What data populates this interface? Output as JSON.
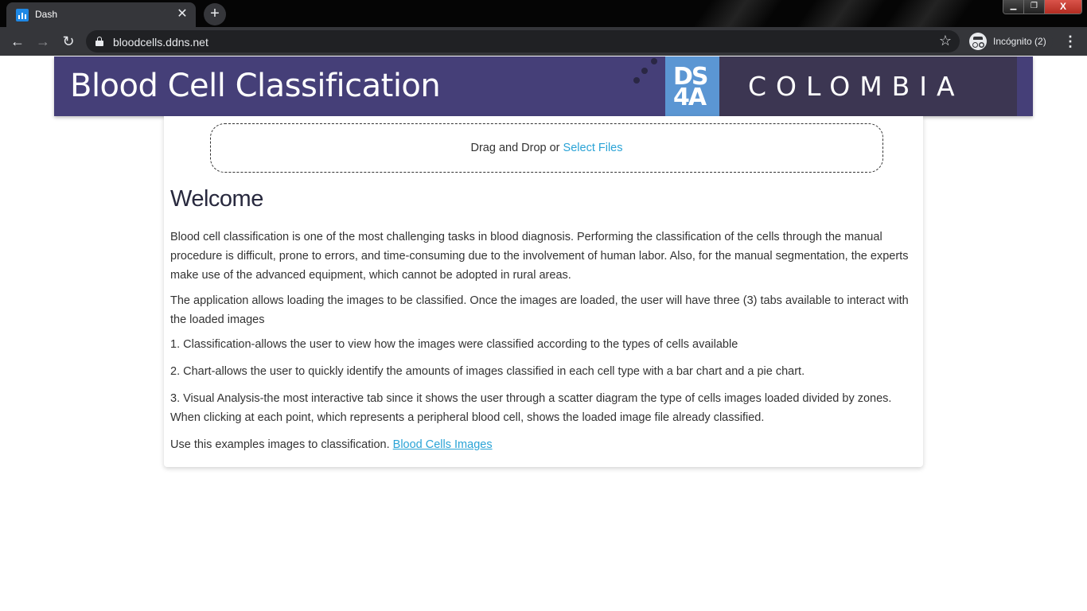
{
  "browser": {
    "tab_title": "Dash",
    "tab_close": "✕",
    "new_tab": "+",
    "url": "bloodcells.ddns.net",
    "incognito_label": "Incógnito (2)",
    "back_glyph": "←",
    "forward_glyph": "→",
    "reload_glyph": "↻",
    "star_glyph": "☆",
    "menu_glyph": "⋮",
    "win_minimize": "▁",
    "win_restore": "❐",
    "win_close": "X"
  },
  "header": {
    "title": "Blood Cell Classification",
    "logo_line1": "DS",
    "logo_line2": "4A",
    "logo_text": "COLOMBIA"
  },
  "upload": {
    "prompt": "Drag and Drop or ",
    "link": "Select Files"
  },
  "content": {
    "heading": "Welcome",
    "p1": "Blood cell classification is one of the most challenging tasks in blood diagnosis. Performing the classification of the cells through the manual procedure is difficult, prone to errors, and time-consuming due to the involvement of human labor. Also, for the manual segmentation, the experts make use of the advanced equipment, which cannot be adopted in rural areas.",
    "p2": "The application allows loading the images to be classified. Once the images are loaded, the user will have three (3) tabs available to interact with the loaded images",
    "item1": "1. Classification-allows the user to view how the images were classified according to the types of cells available",
    "item2": "2. Chart-allows the user to quickly identify the amounts of images classified in each cell type with a bar chart and a pie chart.",
    "item3": "3. Visual Analysis-the most interactive tab since it shows the user through a scatter diagram the type of cells images loaded divided by zones. When clicking at each point, which represents a peripheral blood cell, shows the loaded image file already classified.",
    "examples_text": "Use this examples images to classification. ",
    "examples_link": "Blood Cells Images"
  },
  "colors": {
    "banner": "#453f78",
    "logo_blue": "#5b96d3",
    "link": "#2aa3d6"
  }
}
